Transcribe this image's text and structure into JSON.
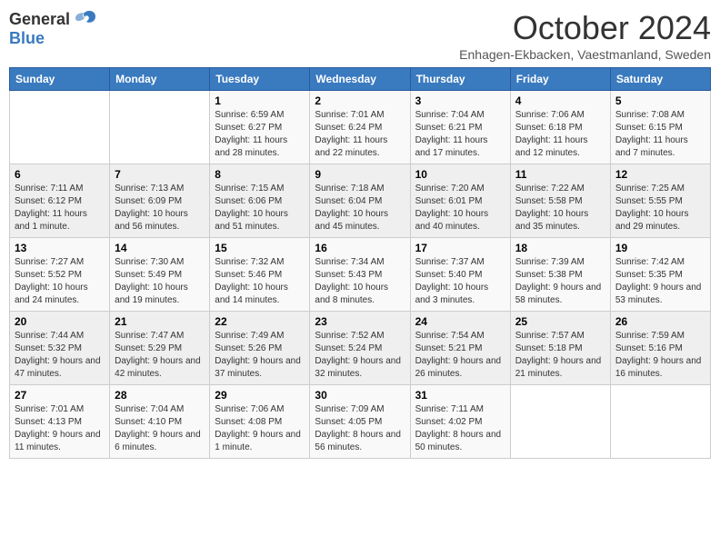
{
  "header": {
    "logo_general": "General",
    "logo_blue": "Blue",
    "month_title": "October 2024",
    "subtitle": "Enhagen-Ekbacken, Vaestmanland, Sweden"
  },
  "days_of_week": [
    "Sunday",
    "Monday",
    "Tuesday",
    "Wednesday",
    "Thursday",
    "Friday",
    "Saturday"
  ],
  "weeks": [
    [
      {
        "day": "",
        "info": ""
      },
      {
        "day": "",
        "info": ""
      },
      {
        "day": "1",
        "info": "Sunrise: 6:59 AM\nSunset: 6:27 PM\nDaylight: 11 hours and 28 minutes."
      },
      {
        "day": "2",
        "info": "Sunrise: 7:01 AM\nSunset: 6:24 PM\nDaylight: 11 hours and 22 minutes."
      },
      {
        "day": "3",
        "info": "Sunrise: 7:04 AM\nSunset: 6:21 PM\nDaylight: 11 hours and 17 minutes."
      },
      {
        "day": "4",
        "info": "Sunrise: 7:06 AM\nSunset: 6:18 PM\nDaylight: 11 hours and 12 minutes."
      },
      {
        "day": "5",
        "info": "Sunrise: 7:08 AM\nSunset: 6:15 PM\nDaylight: 11 hours and 7 minutes."
      }
    ],
    [
      {
        "day": "6",
        "info": "Sunrise: 7:11 AM\nSunset: 6:12 PM\nDaylight: 11 hours and 1 minute."
      },
      {
        "day": "7",
        "info": "Sunrise: 7:13 AM\nSunset: 6:09 PM\nDaylight: 10 hours and 56 minutes."
      },
      {
        "day": "8",
        "info": "Sunrise: 7:15 AM\nSunset: 6:06 PM\nDaylight: 10 hours and 51 minutes."
      },
      {
        "day": "9",
        "info": "Sunrise: 7:18 AM\nSunset: 6:04 PM\nDaylight: 10 hours and 45 minutes."
      },
      {
        "day": "10",
        "info": "Sunrise: 7:20 AM\nSunset: 6:01 PM\nDaylight: 10 hours and 40 minutes."
      },
      {
        "day": "11",
        "info": "Sunrise: 7:22 AM\nSunset: 5:58 PM\nDaylight: 10 hours and 35 minutes."
      },
      {
        "day": "12",
        "info": "Sunrise: 7:25 AM\nSunset: 5:55 PM\nDaylight: 10 hours and 29 minutes."
      }
    ],
    [
      {
        "day": "13",
        "info": "Sunrise: 7:27 AM\nSunset: 5:52 PM\nDaylight: 10 hours and 24 minutes."
      },
      {
        "day": "14",
        "info": "Sunrise: 7:30 AM\nSunset: 5:49 PM\nDaylight: 10 hours and 19 minutes."
      },
      {
        "day": "15",
        "info": "Sunrise: 7:32 AM\nSunset: 5:46 PM\nDaylight: 10 hours and 14 minutes."
      },
      {
        "day": "16",
        "info": "Sunrise: 7:34 AM\nSunset: 5:43 PM\nDaylight: 10 hours and 8 minutes."
      },
      {
        "day": "17",
        "info": "Sunrise: 7:37 AM\nSunset: 5:40 PM\nDaylight: 10 hours and 3 minutes."
      },
      {
        "day": "18",
        "info": "Sunrise: 7:39 AM\nSunset: 5:38 PM\nDaylight: 9 hours and 58 minutes."
      },
      {
        "day": "19",
        "info": "Sunrise: 7:42 AM\nSunset: 5:35 PM\nDaylight: 9 hours and 53 minutes."
      }
    ],
    [
      {
        "day": "20",
        "info": "Sunrise: 7:44 AM\nSunset: 5:32 PM\nDaylight: 9 hours and 47 minutes."
      },
      {
        "day": "21",
        "info": "Sunrise: 7:47 AM\nSunset: 5:29 PM\nDaylight: 9 hours and 42 minutes."
      },
      {
        "day": "22",
        "info": "Sunrise: 7:49 AM\nSunset: 5:26 PM\nDaylight: 9 hours and 37 minutes."
      },
      {
        "day": "23",
        "info": "Sunrise: 7:52 AM\nSunset: 5:24 PM\nDaylight: 9 hours and 32 minutes."
      },
      {
        "day": "24",
        "info": "Sunrise: 7:54 AM\nSunset: 5:21 PM\nDaylight: 9 hours and 26 minutes."
      },
      {
        "day": "25",
        "info": "Sunrise: 7:57 AM\nSunset: 5:18 PM\nDaylight: 9 hours and 21 minutes."
      },
      {
        "day": "26",
        "info": "Sunrise: 7:59 AM\nSunset: 5:16 PM\nDaylight: 9 hours and 16 minutes."
      }
    ],
    [
      {
        "day": "27",
        "info": "Sunrise: 7:01 AM\nSunset: 4:13 PM\nDaylight: 9 hours and 11 minutes."
      },
      {
        "day": "28",
        "info": "Sunrise: 7:04 AM\nSunset: 4:10 PM\nDaylight: 9 hours and 6 minutes."
      },
      {
        "day": "29",
        "info": "Sunrise: 7:06 AM\nSunset: 4:08 PM\nDaylight: 9 hours and 1 minute."
      },
      {
        "day": "30",
        "info": "Sunrise: 7:09 AM\nSunset: 4:05 PM\nDaylight: 8 hours and 56 minutes."
      },
      {
        "day": "31",
        "info": "Sunrise: 7:11 AM\nSunset: 4:02 PM\nDaylight: 8 hours and 50 minutes."
      },
      {
        "day": "",
        "info": ""
      },
      {
        "day": "",
        "info": ""
      }
    ]
  ]
}
